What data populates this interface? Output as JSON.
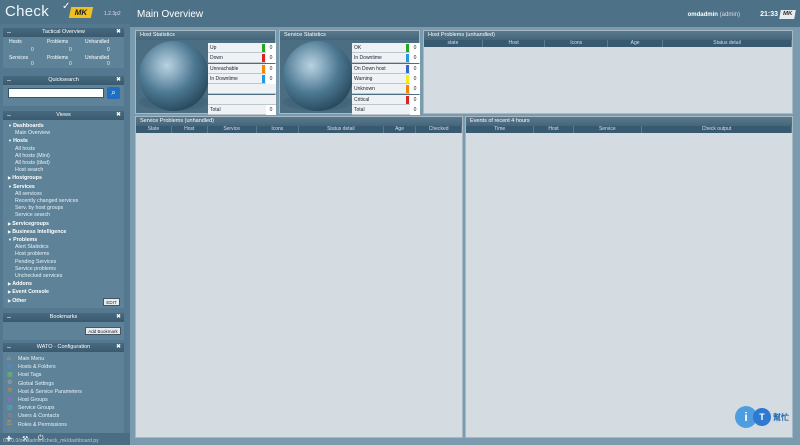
{
  "logo": {
    "word": "Check",
    "mk": "MK",
    "version": "1.2.3p2"
  },
  "header": {
    "title": "Main Overview",
    "user": "omdadmin",
    "role": "(admin)",
    "time": "21:33",
    "logo_small": "MK"
  },
  "tactical": {
    "title": "Tactical Overview",
    "col1": "Problems",
    "col2": "Unhandled",
    "rows": [
      {
        "label": "Hosts",
        "total": "0",
        "problems": "0",
        "unhandled": "0"
      },
      {
        "label": "Services",
        "total": "0",
        "problems": "0",
        "unhandled": "0"
      }
    ]
  },
  "quicksearch": {
    "title": "Quicksearch",
    "value": ""
  },
  "views": {
    "title": "Views",
    "groups": [
      {
        "label": "Dashboards",
        "items": [
          "Main Overview"
        ]
      },
      {
        "label": "Hosts",
        "items": [
          "All hosts",
          "All hosts (Mini)",
          "All hosts (tiled)",
          "Host search"
        ]
      },
      {
        "label": "Hostgroups",
        "items": []
      },
      {
        "label": "Services",
        "items": [
          "All services",
          "Recently changed services",
          "Serv. by host groups",
          "Service search"
        ]
      },
      {
        "label": "Servicegroups",
        "items": []
      },
      {
        "label": "Business Intelligence",
        "items": []
      },
      {
        "label": "Problems",
        "items": [
          "Alert Statistics",
          "Host problems",
          "Pending Services",
          "Service problems",
          "Unchecked services"
        ]
      },
      {
        "label": "Addons",
        "items": []
      },
      {
        "label": "Event Console",
        "items": []
      },
      {
        "label": "Other",
        "items": []
      }
    ],
    "edit_label": "EDIT"
  },
  "bookmarks": {
    "title": "Bookmarks",
    "add_label": "Add Bookmark"
  },
  "wato": {
    "title": "WATO · Configuration",
    "items": [
      "Main Menu",
      "Hosts & Folders",
      "Host Tags",
      "Global Settings",
      "Host & Service Parameters",
      "Host Groups",
      "Service Groups",
      "Users & Contacts",
      "Roles & Permissions"
    ]
  },
  "statusbar": {
    "text": "0.0.0.0/omdadmin/check_mk/dashboard.py"
  },
  "host_stats": {
    "title": "Host Statistics",
    "rows": [
      {
        "label": "Up",
        "value": "0",
        "color": "#22aa22"
      },
      {
        "label": "Down",
        "value": "0",
        "color": "#dd2222"
      },
      {
        "label": "Unreachable",
        "value": "0",
        "color": "#ee8800"
      },
      {
        "label": "In Downtime",
        "value": "0",
        "color": "#2299dd"
      },
      {
        "label": "",
        "value": "",
        "color": ""
      },
      {
        "label": "",
        "value": "",
        "color": ""
      },
      {
        "label": "Total",
        "value": "0",
        "color": ""
      }
    ]
  },
  "service_stats": {
    "title": "Service Statistics",
    "rows": [
      {
        "label": "OK",
        "value": "0",
        "color": "#22aa22"
      },
      {
        "label": "In Downtime",
        "value": "0",
        "color": "#2299dd"
      },
      {
        "label": "On Down host",
        "value": "0",
        "color": "#3366cc"
      },
      {
        "label": "Warning",
        "value": "0",
        "color": "#eeee22"
      },
      {
        "label": "Unknown",
        "value": "0",
        "color": "#ee8800"
      },
      {
        "label": "Critical",
        "value": "0",
        "color": "#dd2222"
      },
      {
        "label": "Total",
        "value": "0",
        "color": ""
      }
    ]
  },
  "host_problems": {
    "title": "Host Problems (unhandled)",
    "columns": [
      "state",
      "Host",
      "Icons",
      "Age",
      "Status detail"
    ]
  },
  "service_problems": {
    "title": "Service Problems (unhandled)",
    "columns": [
      "State",
      "Host",
      "Service",
      "Icons",
      "Status detail",
      "Age",
      "Checked"
    ]
  },
  "events": {
    "title": "Events of recent 4 hours",
    "columns": [
      "Time",
      "Host",
      "Service",
      "Check output"
    ]
  },
  "badge": {
    "text": "幫忙"
  }
}
